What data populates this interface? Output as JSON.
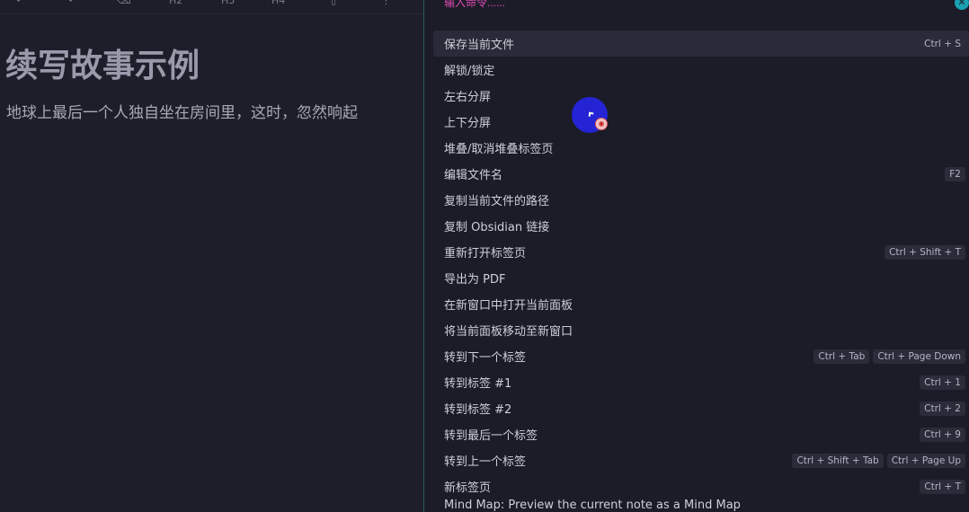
{
  "editor": {
    "toolbar": {
      "icons": [
        "undo-icon",
        "redo-icon",
        "clear-format-icon",
        "heading2-icon",
        "heading3-icon",
        "heading4-icon",
        "copy-icon",
        "more-icon"
      ],
      "heading_labels": [
        "H2",
        "H3",
        "H4"
      ]
    },
    "title": "续写故事示例",
    "body": "地球上最后一个人独自坐在房间里，这时，忽然响起"
  },
  "palette": {
    "input_value": "输入命令......",
    "commands": [
      {
        "label": "保存当前文件",
        "hotkeys": [
          "Ctrl + S"
        ]
      },
      {
        "label": "解锁/锁定",
        "hotkeys": []
      },
      {
        "label": "左右分屏",
        "hotkeys": []
      },
      {
        "label": "上下分屏",
        "hotkeys": []
      },
      {
        "label": "堆叠/取消堆叠标签页",
        "hotkeys": []
      },
      {
        "label": "编辑文件名",
        "hotkeys": [
          "F2"
        ]
      },
      {
        "label": "复制当前文件的路径",
        "hotkeys": []
      },
      {
        "label": "复制 Obsidian 链接",
        "hotkeys": []
      },
      {
        "label": "重新打开标签页",
        "hotkeys": [
          "Ctrl + Shift + T"
        ]
      },
      {
        "label": "导出为 PDF",
        "hotkeys": []
      },
      {
        "label": "在新窗口中打开当前面板",
        "hotkeys": []
      },
      {
        "label": "将当前面板移动至新窗口",
        "hotkeys": []
      },
      {
        "label": "转到下一个标签",
        "hotkeys": [
          "Ctrl + Tab",
          "Ctrl + Page Down"
        ]
      },
      {
        "label": "转到标签 #1",
        "hotkeys": [
          "Ctrl + 1"
        ]
      },
      {
        "label": "转到标签 #2",
        "hotkeys": [
          "Ctrl + 2"
        ]
      },
      {
        "label": "转到最后一个标签",
        "hotkeys": [
          "Ctrl + 9"
        ]
      },
      {
        "label": "转到上一个标签",
        "hotkeys": [
          "Ctrl + Shift + Tab",
          "Ctrl + Page Up"
        ]
      },
      {
        "label": "新标签页",
        "hotkeys": [
          "Ctrl + T"
        ]
      },
      {
        "label": "Mind Map: Preview the current note as a Mind Map",
        "hotkeys": []
      }
    ]
  },
  "colors": {
    "background": "#1e1e2a",
    "palette_bg": "#1c1c28",
    "input_text": "#e04bb6",
    "close_button": "#1aa0b3",
    "cursor": "#2424d4"
  }
}
